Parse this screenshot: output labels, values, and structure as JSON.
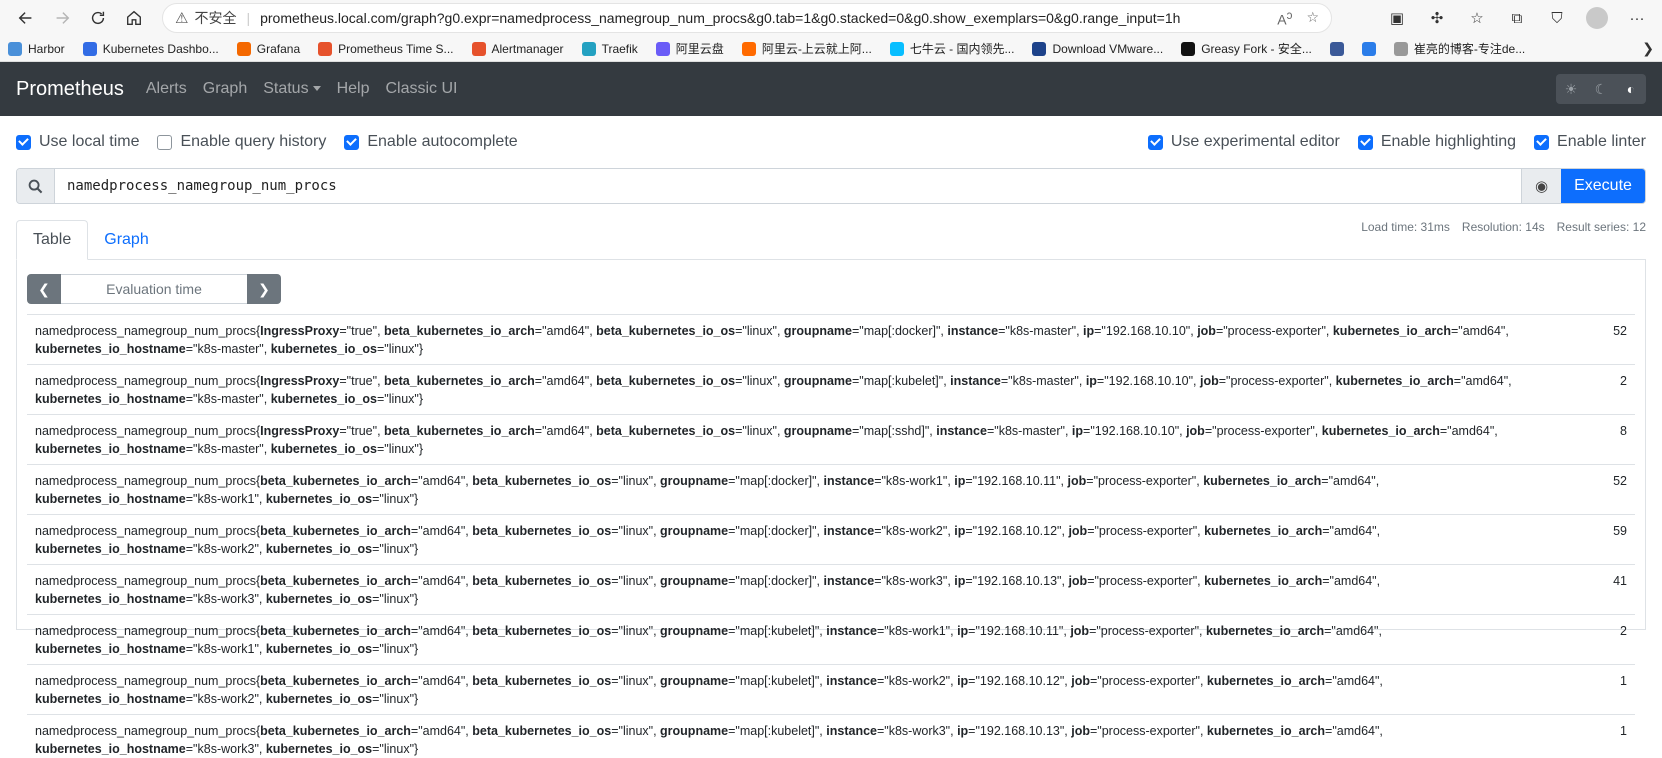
{
  "browser": {
    "insecure_label": "不安全",
    "url": "prometheus.local.com/graph?g0.expr=namedprocess_namegroup_num_procs&g0.tab=1&g0.stacked=0&g0.show_exemplars=0&g0.range_input=1h"
  },
  "bookmarks": [
    {
      "label": "Harbor",
      "color": "#4a90d9"
    },
    {
      "label": "Kubernetes Dashbo...",
      "color": "#326ce5"
    },
    {
      "label": "Grafana",
      "color": "#f46800"
    },
    {
      "label": "Prometheus Time S...",
      "color": "#e6522c"
    },
    {
      "label": "Alertmanager",
      "color": "#e6522c"
    },
    {
      "label": "Traefik",
      "color": "#24a1c1"
    },
    {
      "label": "阿里云盘",
      "color": "#6a5cf7"
    },
    {
      "label": "阿里云-上云就上阿...",
      "color": "#ff6a00"
    },
    {
      "label": "七牛云 - 国内领先...",
      "color": "#07beff"
    },
    {
      "label": "Download VMware...",
      "color": "#1d428a"
    },
    {
      "label": "Greasy Fork - 安全...",
      "color": "#111111"
    },
    {
      "label": "",
      "color": "#3b5998"
    },
    {
      "label": "",
      "color": "#2b7de9"
    },
    {
      "label": "崔亮的博客-专注de...",
      "color": "#999999"
    }
  ],
  "nav": {
    "brand": "Prometheus",
    "alerts": "Alerts",
    "graph": "Graph",
    "status": "Status",
    "help": "Help",
    "classic": "Classic UI"
  },
  "options": {
    "local_time": "Use local time",
    "query_history": "Enable query history",
    "autocomplete": "Enable autocomplete",
    "experimental": "Use experimental editor",
    "highlighting": "Enable highlighting",
    "linter": "Enable linter"
  },
  "query": {
    "expr": "namedprocess_namegroup_num_procs",
    "execute": "Execute"
  },
  "tabs": {
    "table": "Table",
    "graph": "Graph"
  },
  "stats": {
    "load_time": "Load time: 31ms",
    "resolution": "Resolution: 14s",
    "result_series": "Result series: 12"
  },
  "eval": {
    "placeholder": "Evaluation time"
  },
  "metric": "namedprocess_namegroup_num_procs",
  "rows": [
    {
      "labels": [
        [
          "IngressProxy",
          "true"
        ],
        [
          "beta_kubernetes_io_arch",
          "amd64"
        ],
        [
          "beta_kubernetes_io_os",
          "linux"
        ],
        [
          "groupname",
          "map[:docker]"
        ],
        [
          "instance",
          "k8s-master"
        ],
        [
          "ip",
          "192.168.10.10"
        ],
        [
          "job",
          "process-exporter"
        ],
        [
          "kubernetes_io_arch",
          "amd64"
        ],
        [
          "kubernetes_io_hostname",
          "k8s-master"
        ],
        [
          "kubernetes_io_os",
          "linux"
        ]
      ],
      "value": "52"
    },
    {
      "labels": [
        [
          "IngressProxy",
          "true"
        ],
        [
          "beta_kubernetes_io_arch",
          "amd64"
        ],
        [
          "beta_kubernetes_io_os",
          "linux"
        ],
        [
          "groupname",
          "map[:kubelet]"
        ],
        [
          "instance",
          "k8s-master"
        ],
        [
          "ip",
          "192.168.10.10"
        ],
        [
          "job",
          "process-exporter"
        ],
        [
          "kubernetes_io_arch",
          "amd64"
        ],
        [
          "kubernetes_io_hostname",
          "k8s-master"
        ],
        [
          "kubernetes_io_os",
          "linux"
        ]
      ],
      "value": "2"
    },
    {
      "labels": [
        [
          "IngressProxy",
          "true"
        ],
        [
          "beta_kubernetes_io_arch",
          "amd64"
        ],
        [
          "beta_kubernetes_io_os",
          "linux"
        ],
        [
          "groupname",
          "map[:sshd]"
        ],
        [
          "instance",
          "k8s-master"
        ],
        [
          "ip",
          "192.168.10.10"
        ],
        [
          "job",
          "process-exporter"
        ],
        [
          "kubernetes_io_arch",
          "amd64"
        ],
        [
          "kubernetes_io_hostname",
          "k8s-master"
        ],
        [
          "kubernetes_io_os",
          "linux"
        ]
      ],
      "value": "8"
    },
    {
      "labels": [
        [
          "beta_kubernetes_io_arch",
          "amd64"
        ],
        [
          "beta_kubernetes_io_os",
          "linux"
        ],
        [
          "groupname",
          "map[:docker]"
        ],
        [
          "instance",
          "k8s-work1"
        ],
        [
          "ip",
          "192.168.10.11"
        ],
        [
          "job",
          "process-exporter"
        ],
        [
          "kubernetes_io_arch",
          "amd64"
        ],
        [
          "kubernetes_io_hostname",
          "k8s-work1"
        ],
        [
          "kubernetes_io_os",
          "linux"
        ]
      ],
      "value": "52"
    },
    {
      "labels": [
        [
          "beta_kubernetes_io_arch",
          "amd64"
        ],
        [
          "beta_kubernetes_io_os",
          "linux"
        ],
        [
          "groupname",
          "map[:docker]"
        ],
        [
          "instance",
          "k8s-work2"
        ],
        [
          "ip",
          "192.168.10.12"
        ],
        [
          "job",
          "process-exporter"
        ],
        [
          "kubernetes_io_arch",
          "amd64"
        ],
        [
          "kubernetes_io_hostname",
          "k8s-work2"
        ],
        [
          "kubernetes_io_os",
          "linux"
        ]
      ],
      "value": "59"
    },
    {
      "labels": [
        [
          "beta_kubernetes_io_arch",
          "amd64"
        ],
        [
          "beta_kubernetes_io_os",
          "linux"
        ],
        [
          "groupname",
          "map[:docker]"
        ],
        [
          "instance",
          "k8s-work3"
        ],
        [
          "ip",
          "192.168.10.13"
        ],
        [
          "job",
          "process-exporter"
        ],
        [
          "kubernetes_io_arch",
          "amd64"
        ],
        [
          "kubernetes_io_hostname",
          "k8s-work3"
        ],
        [
          "kubernetes_io_os",
          "linux"
        ]
      ],
      "value": "41"
    },
    {
      "labels": [
        [
          "beta_kubernetes_io_arch",
          "amd64"
        ],
        [
          "beta_kubernetes_io_os",
          "linux"
        ],
        [
          "groupname",
          "map[:kubelet]"
        ],
        [
          "instance",
          "k8s-work1"
        ],
        [
          "ip",
          "192.168.10.11"
        ],
        [
          "job",
          "process-exporter"
        ],
        [
          "kubernetes_io_arch",
          "amd64"
        ],
        [
          "kubernetes_io_hostname",
          "k8s-work1"
        ],
        [
          "kubernetes_io_os",
          "linux"
        ]
      ],
      "value": "2"
    },
    {
      "labels": [
        [
          "beta_kubernetes_io_arch",
          "amd64"
        ],
        [
          "beta_kubernetes_io_os",
          "linux"
        ],
        [
          "groupname",
          "map[:kubelet]"
        ],
        [
          "instance",
          "k8s-work2"
        ],
        [
          "ip",
          "192.168.10.12"
        ],
        [
          "job",
          "process-exporter"
        ],
        [
          "kubernetes_io_arch",
          "amd64"
        ],
        [
          "kubernetes_io_hostname",
          "k8s-work2"
        ],
        [
          "kubernetes_io_os",
          "linux"
        ]
      ],
      "value": "1"
    },
    {
      "labels": [
        [
          "beta_kubernetes_io_arch",
          "amd64"
        ],
        [
          "beta_kubernetes_io_os",
          "linux"
        ],
        [
          "groupname",
          "map[:kubelet]"
        ],
        [
          "instance",
          "k8s-work3"
        ],
        [
          "ip",
          "192.168.10.13"
        ],
        [
          "job",
          "process-exporter"
        ],
        [
          "kubernetes_io_arch",
          "amd64"
        ],
        [
          "kubernetes_io_hostname",
          "k8s-work3"
        ],
        [
          "kubernetes_io_os",
          "linux"
        ]
      ],
      "value": "1"
    }
  ]
}
